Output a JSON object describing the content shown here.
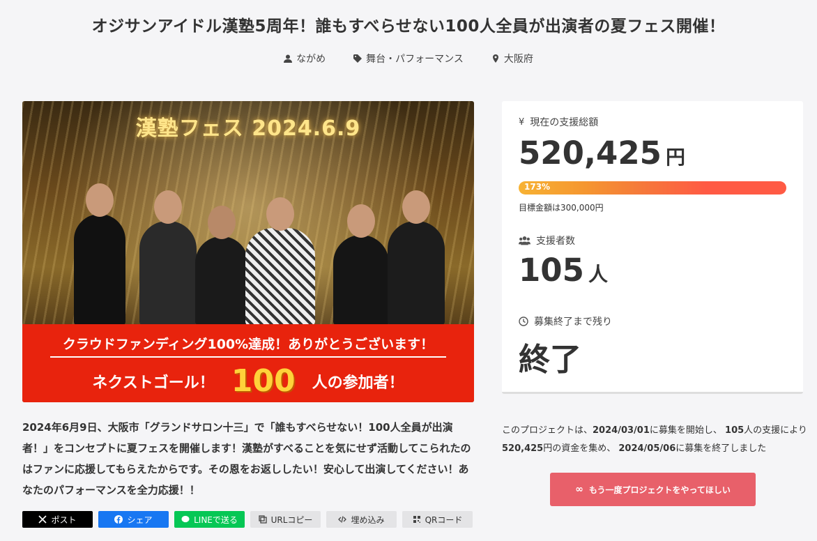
{
  "project": {
    "title": "オジサンアイドル漢塾5周年！誰もすべらせない100人全員が出演者の夏フェス開催！",
    "owner": "ながめ",
    "category": "舞台・パフォーマンス",
    "location": "大阪府"
  },
  "hero": {
    "title": "漢塾フェス 2024.6.9",
    "banner_line1": "クラウドファンディング100%達成！ありがとうございます！",
    "banner_next_goal": "ネクストゴール！",
    "banner_number": "100",
    "banner_suffix": "人の参加者！"
  },
  "stats": {
    "amount_label": "現在の支援総額",
    "amount": "520,425",
    "amount_unit": "円",
    "progress_percent": 173,
    "progress_text": "173%",
    "goal_text": "目標金額は300,000円",
    "supporters_label": "支援者数",
    "supporters": "105",
    "supporters_unit": "人",
    "remaining_label": "募集終了まで残り",
    "remaining": "終了"
  },
  "description": "2024年6月9日、大阪市「グランドサロン十三」で「誰もすべらせない！100人全員が出演者！」をコンセプトに夏フェスを開催します！漢塾がすべることを気にせず活動してこられたのはファンに応援してもらえたからです。その恩をお返ししたい！安心して出演してください！あなたのパフォーマンスを全力応援！！",
  "share": {
    "x": "ポスト",
    "facebook": "シェア",
    "line": "LINEで送る",
    "url_copy": "URLコピー",
    "embed": "埋め込み",
    "qr": "QRコード"
  },
  "summary": {
    "part1": "このプロジェクトは、",
    "start_date": "2024/03/01",
    "part2": "に募集を開始し、",
    "count": "105",
    "part3": "人の支援により",
    "amount": "520,425",
    "part4": "円の資金を集め、",
    "end_date": "2024/05/06",
    "part5": "に募集を終了しました"
  },
  "again_button": "もう一度プロジェクトをやってほしい",
  "colors": {
    "banner": "#e8230d",
    "progress_start": "#f7b233",
    "progress_end": "#ff5a44",
    "again_button": "#e8606a"
  }
}
